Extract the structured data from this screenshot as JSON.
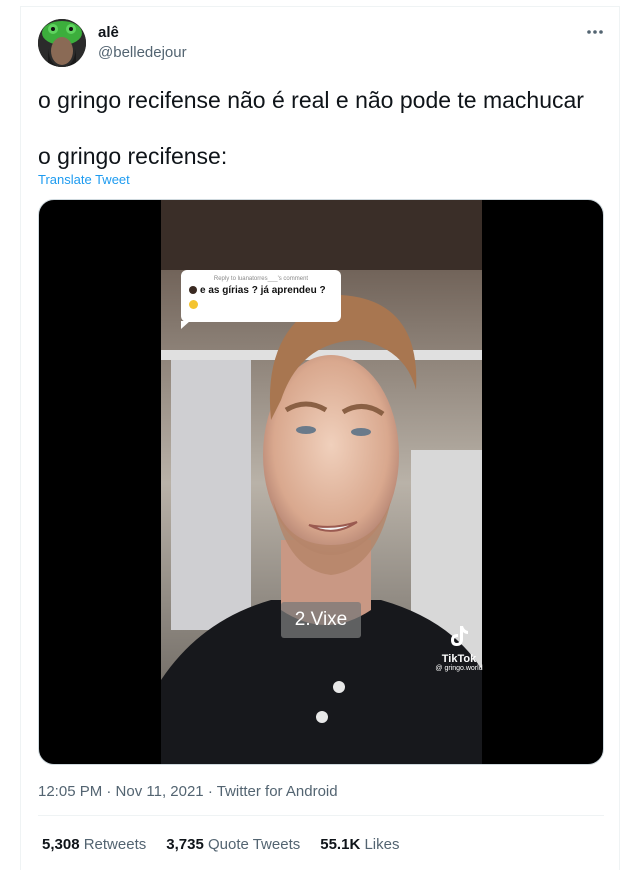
{
  "user": {
    "display_name": "alê",
    "handle": "@belledejour"
  },
  "tweet": {
    "line1": "o gringo recifense não é real e não pode te machucar",
    "line2": "o gringo recifense:",
    "translate_label": "Translate Tweet"
  },
  "video": {
    "reply_to": "Reply to luanatorres___'s comment",
    "reply_text": "e as gírias ? já aprendeu ?",
    "caption": "2.Vixe",
    "tiktok_label": "TikTok",
    "tiktok_user": "@ gringo.world"
  },
  "meta": {
    "timestamp": "12:05 PM · Nov 11, 2021 · Twitter for Android"
  },
  "stats": {
    "retweets_count": "5,308",
    "retweets_label": "Retweets",
    "quotes_count": "3,735",
    "quotes_label": "Quote Tweets",
    "likes_count": "55.1K",
    "likes_label": "Likes"
  },
  "icons": {
    "more": "more-horizontal-icon",
    "tiktok": "tiktok-logo-icon"
  },
  "colors": {
    "link": "#1d9bf0",
    "secondary_text": "#536471",
    "primary_text": "#0f1419"
  }
}
